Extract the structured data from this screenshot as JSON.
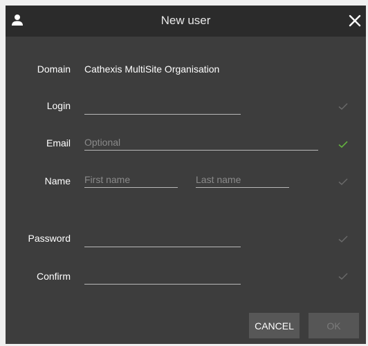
{
  "dialog": {
    "title": "New user",
    "icons": {
      "title": "user-icon",
      "close": "close-icon"
    }
  },
  "form": {
    "domain": {
      "label": "Domain",
      "value": "Cathexis MultiSite Organisation"
    },
    "login": {
      "label": "Login",
      "value": "",
      "placeholder": ""
    },
    "email": {
      "label": "Email",
      "value": "",
      "placeholder": "Optional"
    },
    "name": {
      "label": "Name",
      "first_placeholder": "First name",
      "last_placeholder": "Last name"
    },
    "password": {
      "label": "Password",
      "value": ""
    },
    "confirm": {
      "label": "Confirm",
      "value": ""
    }
  },
  "buttons": {
    "cancel": "CANCEL",
    "ok": "OK"
  },
  "colors": {
    "dialog_bg": "#3d3d3d",
    "titlebar_bg": "#2b2b2b",
    "check_valid": "#63b23f",
    "check_pending": "#6a6a6a"
  }
}
